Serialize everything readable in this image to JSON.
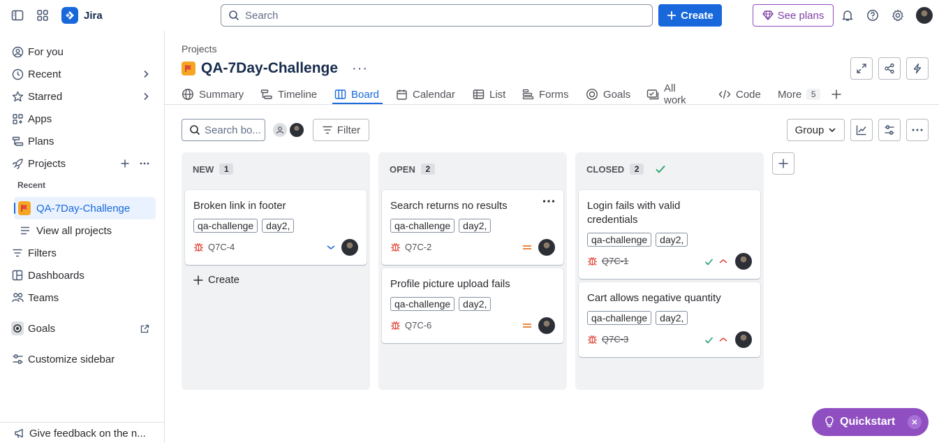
{
  "app": {
    "name": "Jira"
  },
  "search": {
    "placeholder": "Search"
  },
  "topbar": {
    "create_label": "Create",
    "plans_label": "See plans"
  },
  "sidebar": {
    "items": [
      {
        "label": "For you"
      },
      {
        "label": "Recent"
      },
      {
        "label": "Starred"
      },
      {
        "label": "Apps"
      },
      {
        "label": "Plans"
      },
      {
        "label": "Projects"
      }
    ],
    "recent_label": "Recent",
    "active_project": "QA-7Day-Challenge",
    "view_all": "View all projects",
    "lower_items": [
      {
        "label": "Filters"
      },
      {
        "label": "Dashboards"
      },
      {
        "label": "Teams"
      },
      {
        "label": "Goals"
      },
      {
        "label": "Customize sidebar"
      }
    ],
    "feedback": "Give feedback on the n..."
  },
  "header": {
    "breadcrumb": "Projects",
    "title": "QA-7Day-Challenge",
    "more": "···"
  },
  "tabs": [
    {
      "label": "Summary"
    },
    {
      "label": "Timeline"
    },
    {
      "label": "Board"
    },
    {
      "label": "Calendar"
    },
    {
      "label": "List"
    },
    {
      "label": "Forms"
    },
    {
      "label": "Goals"
    },
    {
      "label": "All work"
    },
    {
      "label": "Code"
    },
    {
      "label": "More",
      "count": "5"
    }
  ],
  "toolbar": {
    "search_placeholder": "Search bo...",
    "filter_label": "Filter",
    "group_label": "Group"
  },
  "columns": [
    {
      "name": "NEW",
      "count": "1",
      "create_label": "Create",
      "cards": [
        {
          "title": "Broken link in footer",
          "labels": [
            "qa-challenge",
            "day2,"
          ],
          "key": "Q7C-4",
          "priority": "low"
        }
      ]
    },
    {
      "name": "OPEN",
      "count": "2",
      "cards": [
        {
          "title": "Search returns no results",
          "labels": [
            "qa-challenge",
            "day2,"
          ],
          "key": "Q7C-2",
          "priority": "medium"
        },
        {
          "title": "Profile picture upload fails",
          "labels": [
            "qa-challenge",
            "day2,"
          ],
          "key": "Q7C-6",
          "priority": "medium"
        }
      ]
    },
    {
      "name": "CLOSED",
      "count": "2",
      "cards": [
        {
          "title": "Login fails with valid credentials",
          "labels": [
            "qa-challenge",
            "day2,"
          ],
          "key": "Q7C-1",
          "priority": "high",
          "done": true
        },
        {
          "title": "Cart allows negative quantity",
          "labels": [
            "qa-challenge",
            "day2,"
          ],
          "key": "Q7C-3",
          "priority": "high",
          "done": true
        }
      ]
    }
  ],
  "quickstart": {
    "label": "Quickstart"
  },
  "colors": {
    "accent": "#1868db",
    "purple": "#8f4fc1",
    "bug": "#e2483d",
    "done_check": "#22a06b"
  }
}
